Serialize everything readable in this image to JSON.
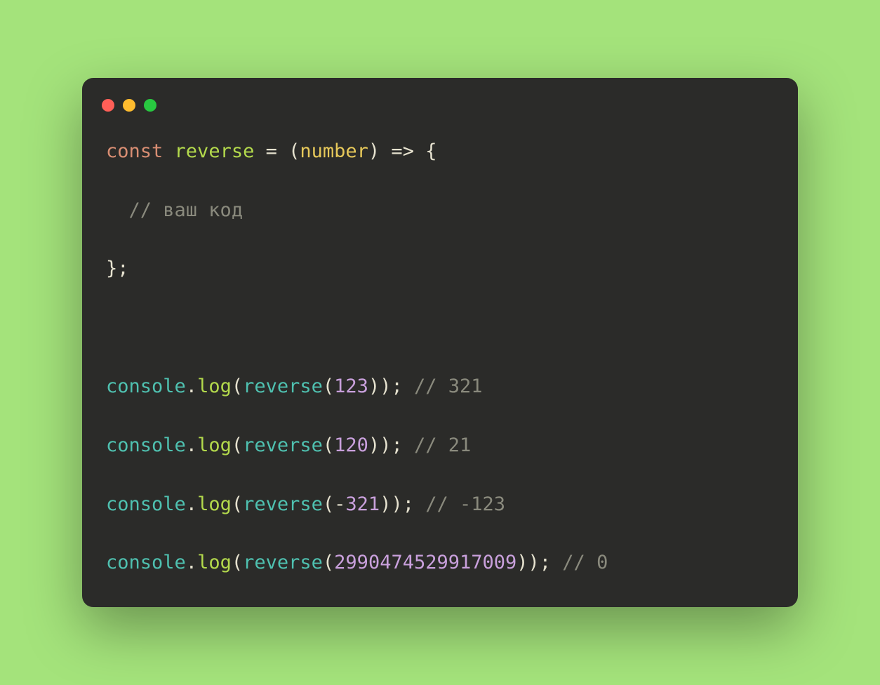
{
  "colors": {
    "background": "#a4e37b",
    "window": "#2b2b29",
    "keyword": "#d98e73",
    "function": "#b3d94c",
    "call": "#4fc1b0",
    "param": "#e6c85a",
    "number": "#c9a0dc",
    "comment": "#8a8a7d",
    "default": "#e6e2cf"
  },
  "traffic": {
    "red": "#ff5f57",
    "yellow": "#febc2e",
    "green": "#28c840"
  },
  "code": {
    "lines": [
      [
        {
          "text": "const",
          "cls": "tok-keyword"
        },
        {
          "text": " ",
          "cls": "tok-default"
        },
        {
          "text": "reverse",
          "cls": "tok-fn"
        },
        {
          "text": " = (",
          "cls": "tok-default"
        },
        {
          "text": "number",
          "cls": "tok-param"
        },
        {
          "text": ") => {",
          "cls": "tok-default"
        }
      ],
      [
        {
          "text": "  ",
          "cls": "tok-default"
        },
        {
          "text": "// ваш код",
          "cls": "tok-comment"
        }
      ],
      [
        {
          "text": "};",
          "cls": "tok-default"
        }
      ],
      [
        {
          "text": "",
          "cls": "tok-default"
        }
      ],
      [
        {
          "text": "console",
          "cls": "tok-call"
        },
        {
          "text": ".",
          "cls": "tok-default"
        },
        {
          "text": "log",
          "cls": "tok-fn"
        },
        {
          "text": "(",
          "cls": "tok-default"
        },
        {
          "text": "reverse",
          "cls": "tok-call"
        },
        {
          "text": "(",
          "cls": "tok-default"
        },
        {
          "text": "123",
          "cls": "tok-num"
        },
        {
          "text": ")); ",
          "cls": "tok-default"
        },
        {
          "text": "// 321",
          "cls": "tok-comment"
        }
      ],
      [
        {
          "text": "console",
          "cls": "tok-call"
        },
        {
          "text": ".",
          "cls": "tok-default"
        },
        {
          "text": "log",
          "cls": "tok-fn"
        },
        {
          "text": "(",
          "cls": "tok-default"
        },
        {
          "text": "reverse",
          "cls": "tok-call"
        },
        {
          "text": "(",
          "cls": "tok-default"
        },
        {
          "text": "120",
          "cls": "tok-num"
        },
        {
          "text": ")); ",
          "cls": "tok-default"
        },
        {
          "text": "// 21",
          "cls": "tok-comment"
        }
      ],
      [
        {
          "text": "console",
          "cls": "tok-call"
        },
        {
          "text": ".",
          "cls": "tok-default"
        },
        {
          "text": "log",
          "cls": "tok-fn"
        },
        {
          "text": "(",
          "cls": "tok-default"
        },
        {
          "text": "reverse",
          "cls": "tok-call"
        },
        {
          "text": "(-",
          "cls": "tok-default"
        },
        {
          "text": "321",
          "cls": "tok-num"
        },
        {
          "text": ")); ",
          "cls": "tok-default"
        },
        {
          "text": "// -123",
          "cls": "tok-comment"
        }
      ],
      [
        {
          "text": "console",
          "cls": "tok-call"
        },
        {
          "text": ".",
          "cls": "tok-default"
        },
        {
          "text": "log",
          "cls": "tok-fn"
        },
        {
          "text": "(",
          "cls": "tok-default"
        },
        {
          "text": "reverse",
          "cls": "tok-call"
        },
        {
          "text": "(",
          "cls": "tok-default"
        },
        {
          "text": "2990474529917009",
          "cls": "tok-num"
        },
        {
          "text": ")); ",
          "cls": "tok-default"
        },
        {
          "text": "// 0",
          "cls": "tok-comment"
        }
      ]
    ]
  }
}
